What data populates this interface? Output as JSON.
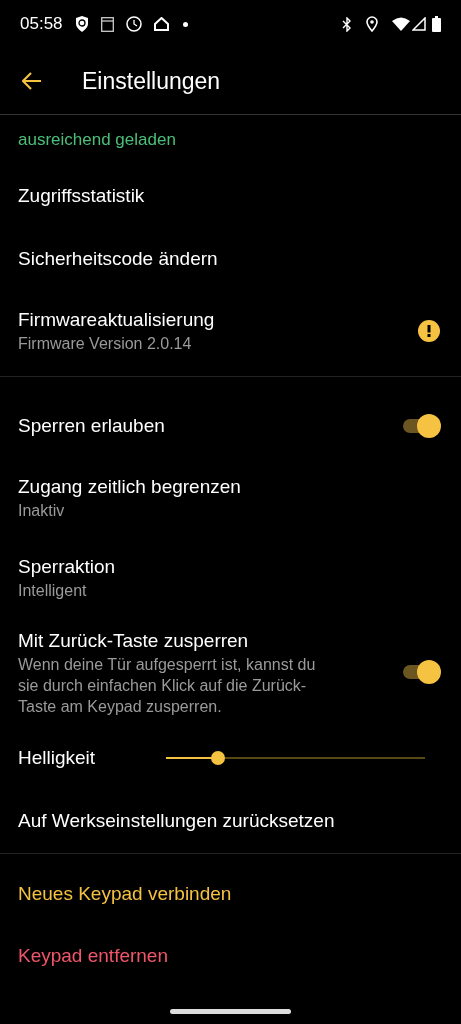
{
  "status_bar": {
    "time": "05:58"
  },
  "app_bar": {
    "title": "Einstellungen"
  },
  "battery_status": "ausreichend geladen",
  "groups": [
    {
      "items": [
        {
          "kind": "plain",
          "title": "Zugriffsstatistik"
        },
        {
          "kind": "plain",
          "title": "Sicherheitscode ändern"
        },
        {
          "kind": "warning",
          "title": "Firmwareaktualisierung",
          "subtitle": "Firmware Version 2.0.14"
        }
      ]
    },
    {
      "items": [
        {
          "kind": "toggle",
          "title": "Sperren erlauben",
          "on": true
        },
        {
          "kind": "plain",
          "title": "Zugang zeitlich begrenzen",
          "subtitle": "Inaktiv"
        },
        {
          "kind": "plain",
          "title": "Sperraktion",
          "subtitle": "Intelligent"
        },
        {
          "kind": "toggle",
          "title": "Mit Zurück-Taste zusperren",
          "subtitle": "Wenn deine Tür aufgesperrt ist, kannst du sie durch einfachen Klick auf die Zurück-Taste am Keypad zusperren.",
          "on": true
        },
        {
          "kind": "slider",
          "title": "Helligkeit",
          "level": 0.2
        },
        {
          "kind": "plain",
          "title": "Auf Werkseinstellungen zurücksetzen"
        }
      ]
    }
  ],
  "actions": [
    {
      "label": "Neues Keypad verbinden",
      "color": "#f5c242"
    },
    {
      "label": "Keypad entfernen",
      "color": "#f0566a"
    }
  ]
}
